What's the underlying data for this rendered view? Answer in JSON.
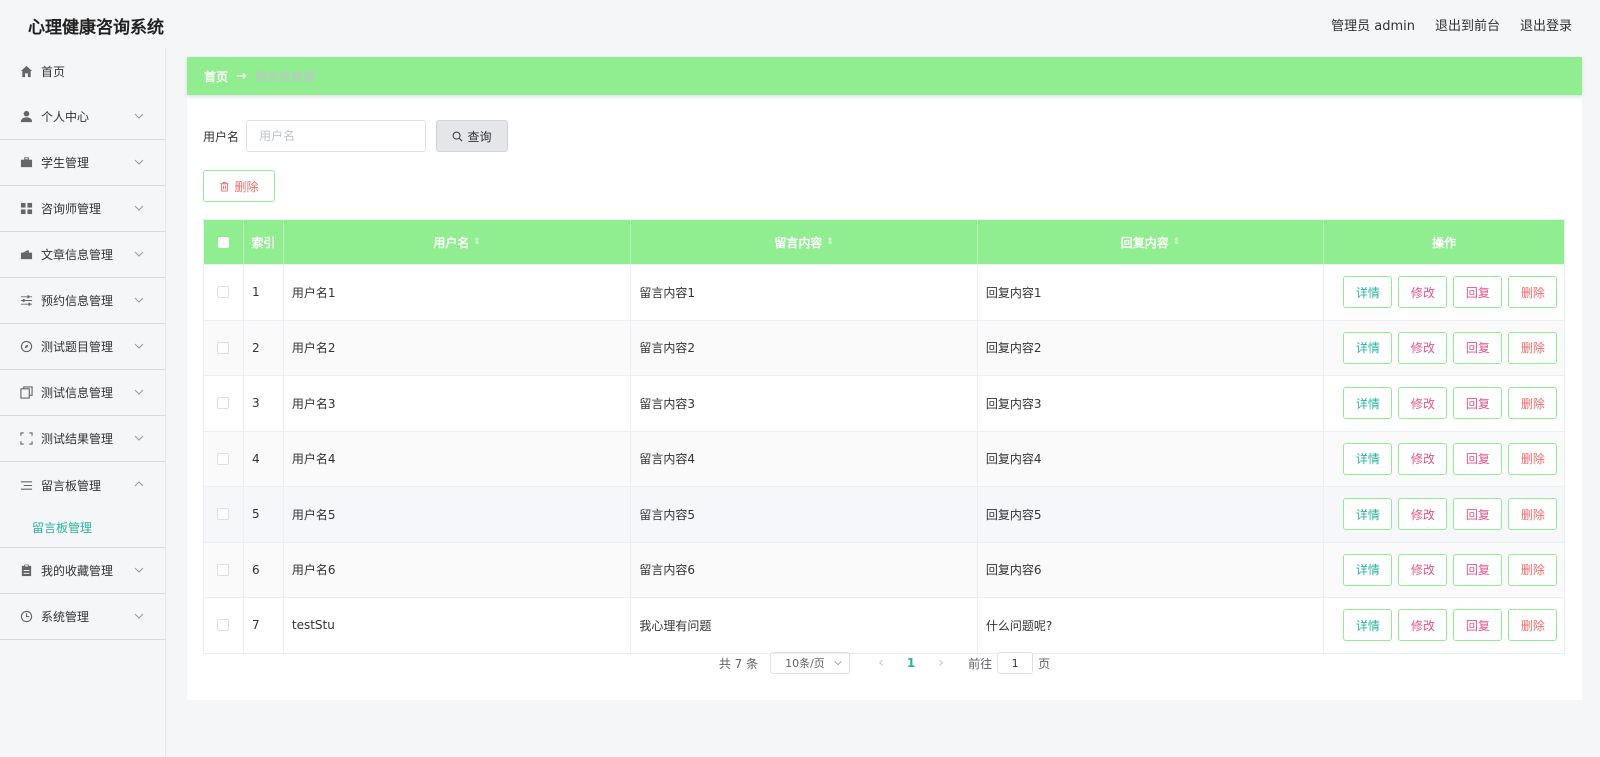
{
  "app": {
    "title": "心理健康咨询系统",
    "user_label": "管理员 admin",
    "front_link": "退出到前台",
    "logout_link": "退出登录"
  },
  "sidebar": {
    "items": [
      {
        "label": "首页",
        "icon": "home-icon"
      },
      {
        "label": "个人中心",
        "icon": "user-icon"
      },
      {
        "label": "学生管理",
        "icon": "briefcase-icon"
      },
      {
        "label": "咨询师管理",
        "icon": "grid-icon"
      },
      {
        "label": "文章信息管理",
        "icon": "wallet-icon"
      },
      {
        "label": "预约信息管理",
        "icon": "sliders-icon"
      },
      {
        "label": "测试题目管理",
        "icon": "compass-icon"
      },
      {
        "label": "测试信息管理",
        "icon": "copy-icon"
      },
      {
        "label": "测试结果管理",
        "icon": "fullscreen-icon"
      },
      {
        "label": "留言板管理",
        "icon": "list-icon"
      },
      {
        "label": "我的收藏管理",
        "icon": "clipboard-icon"
      },
      {
        "label": "系统管理",
        "icon": "clock-icon"
      }
    ],
    "sub_item": "留言板管理"
  },
  "breadcrumb": {
    "home": "首页",
    "separator": "→",
    "current": "留言板管理"
  },
  "search": {
    "label": "用户名",
    "placeholder": "用户名",
    "button": "查询"
  },
  "actions": {
    "delete": "删除"
  },
  "table": {
    "headers": {
      "index": "索引",
      "username": "用户名",
      "message": "留言内容",
      "reply": "回复内容",
      "ops": "操作"
    },
    "rows": [
      {
        "index": "1",
        "username": "用户名1",
        "message": "留言内容1",
        "reply": "回复内容1"
      },
      {
        "index": "2",
        "username": "用户名2",
        "message": "留言内容2",
        "reply": "回复内容2"
      },
      {
        "index": "3",
        "username": "用户名3",
        "message": "留言内容3",
        "reply": "回复内容3"
      },
      {
        "index": "4",
        "username": "用户名4",
        "message": "留言内容4",
        "reply": "回复内容4"
      },
      {
        "index": "5",
        "username": "用户名5",
        "message": "留言内容5",
        "reply": "回复内容5"
      },
      {
        "index": "6",
        "username": "用户名6",
        "message": "留言内容6",
        "reply": "回复内容6"
      },
      {
        "index": "7",
        "username": "testStu",
        "message": "我心理有问题",
        "reply": "什么问题呢?"
      }
    ],
    "op_labels": {
      "detail": "详情",
      "edit": "修改",
      "reply": "回复",
      "delete": "删除"
    }
  },
  "pager": {
    "total": "共 7 条",
    "page_size": "10条/页",
    "current_page": "1",
    "goto_label": "前往",
    "goto_value": "1",
    "page_suffix": "页"
  },
  "colors": {
    "accent_green": "#90ee90",
    "teal": "#2bb5a0",
    "danger": "#f56c6c",
    "pink": "#e6548c"
  }
}
